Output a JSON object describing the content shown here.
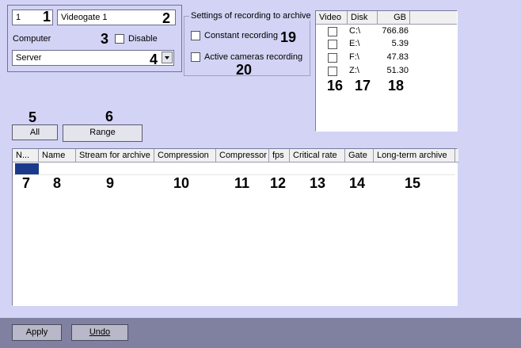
{
  "camera": {
    "id_value": "1",
    "name_value": "Videogate 1",
    "computer_label": "Computer",
    "disable_label": "Disable",
    "computer_value": "Server"
  },
  "recording": {
    "title": "Settings of recording to archive",
    "constant_label": "Constant recording",
    "active_label": "Active cameras recording"
  },
  "disks": {
    "headers": [
      "Video",
      "Disk",
      "GB"
    ],
    "rows": [
      {
        "disk": "C:\\",
        "gb": "766.86"
      },
      {
        "disk": "E:\\",
        "gb": "5.39"
      },
      {
        "disk": "F:\\",
        "gb": "47.83"
      },
      {
        "disk": "Z:\\",
        "gb": "51.30"
      }
    ]
  },
  "buttons": {
    "all": "All",
    "range": "Range",
    "apply": "Apply",
    "undo": "Undo"
  },
  "table": {
    "headers": [
      "N...",
      "Name",
      "Stream for archive",
      "Compression",
      "Compressor",
      "fps",
      "Critical rate",
      "Gate",
      "Long-term archive"
    ]
  },
  "callouts": {
    "c1": "1",
    "c2": "2",
    "c3": "3",
    "c4": "4",
    "c5": "5",
    "c6": "6",
    "c7": "7",
    "c8": "8",
    "c9": "9",
    "c10": "10",
    "c11": "11",
    "c12": "12",
    "c13": "13",
    "c14": "14",
    "c15": "15",
    "c16": "16",
    "c17": "17",
    "c18": "18",
    "c19": "19",
    "c20": "20"
  }
}
